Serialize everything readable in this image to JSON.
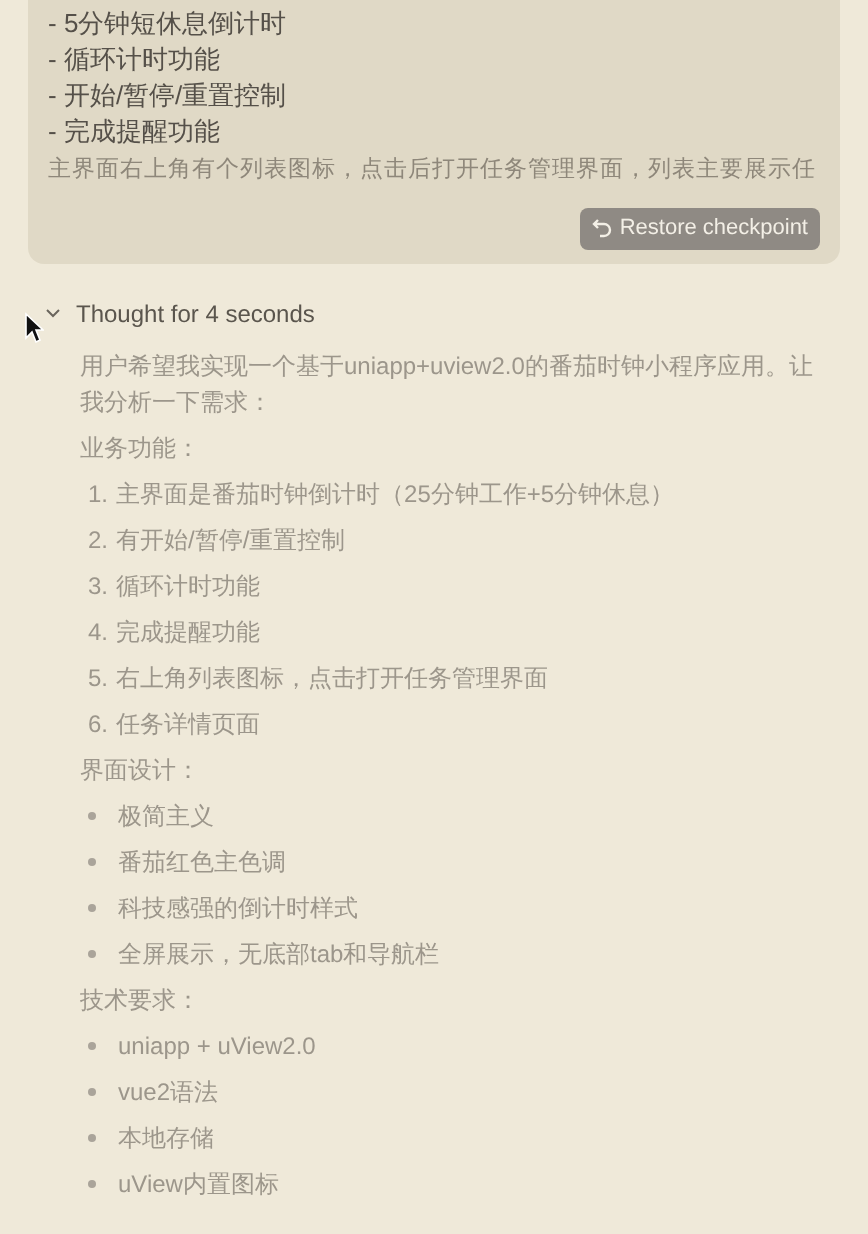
{
  "user_message": {
    "lines": [
      "- 5分钟短休息倒计时",
      "- 循环计时功能",
      "- 开始/暂停/重置控制",
      "- 完成提醒功能"
    ],
    "faded_line": "主界面右上角有个列表图标，点击后打开任务管理界面，列表主要展示任",
    "restore_button": "Restore checkpoint"
  },
  "thought": {
    "title": "Thought for 4 seconds",
    "expanded": true,
    "blocks": [
      {
        "kind": "paragraph",
        "text": "用户希望我实现一个基于uniapp+uview2.0的番茄时钟小程序应用。让我分析一下需求："
      },
      {
        "kind": "heading",
        "text": "业务功能："
      },
      {
        "kind": "ordered",
        "items": [
          {
            "marker": "1.",
            "text": "主界面是番茄时钟倒计时（25分钟工作+5分钟休息）"
          },
          {
            "marker": "2.",
            "text": "有开始/暂停/重置控制"
          },
          {
            "marker": "3.",
            "text": "循环计时功能"
          },
          {
            "marker": "4.",
            "text": "完成提醒功能"
          },
          {
            "marker": "5.",
            "text": "右上角列表图标，点击打开任务管理界面"
          },
          {
            "marker": "6.",
            "text": "任务详情页面"
          }
        ]
      },
      {
        "kind": "heading",
        "text": "界面设计："
      },
      {
        "kind": "bullets",
        "items": [
          {
            "text": "极简主义"
          },
          {
            "text": "番茄红色主色调"
          },
          {
            "text": "科技感强的倒计时样式"
          },
          {
            "text": "全屏展示，无底部tab和导航栏"
          }
        ]
      },
      {
        "kind": "heading",
        "text": "技术要求："
      },
      {
        "kind": "bullets",
        "items": [
          {
            "text": "uniapp + uView2.0"
          },
          {
            "text": "vue2语法"
          },
          {
            "text": "本地存储"
          },
          {
            "text": "uView内置图标"
          }
        ]
      }
    ]
  }
}
